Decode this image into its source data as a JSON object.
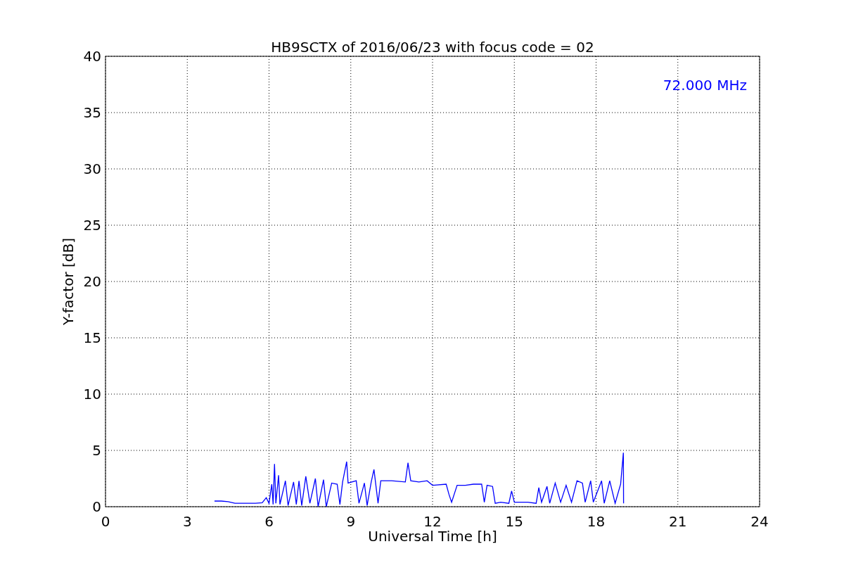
{
  "figure": {
    "chart_data": {
      "type": "line",
      "title": "HB9SCTX of 2016/06/23 with focus code = 02",
      "xlabel": "Universal Time [h]",
      "ylabel": "Y-factor [dB]",
      "xlim": [
        0,
        24
      ],
      "ylim": [
        0,
        40
      ],
      "xticks": [
        0,
        3,
        6,
        9,
        12,
        15,
        18,
        21,
        24
      ],
      "yticks": [
        0,
        5,
        10,
        15,
        20,
        25,
        30,
        35,
        40
      ],
      "x": [
        4.0,
        4.25,
        4.5,
        4.75,
        5.0,
        5.25,
        5.5,
        5.75,
        5.9,
        6.0,
        6.1,
        6.15,
        6.2,
        6.25,
        6.35,
        6.4,
        6.6,
        6.7,
        6.9,
        7.0,
        7.1,
        7.2,
        7.35,
        7.5,
        7.7,
        7.8,
        8.0,
        8.1,
        8.3,
        8.5,
        8.6,
        8.7,
        8.85,
        8.9,
        9.2,
        9.3,
        9.5,
        9.6,
        9.75,
        9.85,
        10.0,
        10.1,
        10.5,
        11.0,
        11.1,
        11.2,
        11.5,
        11.8,
        12.0,
        12.5,
        12.6,
        12.7,
        12.9,
        13.2,
        13.5,
        13.8,
        13.9,
        14.0,
        14.2,
        14.3,
        14.5,
        14.8,
        14.9,
        15.0,
        15.5,
        15.8,
        15.9,
        16.0,
        16.2,
        16.3,
        16.5,
        16.7,
        16.9,
        17.1,
        17.3,
        17.5,
        17.6,
        17.8,
        17.9,
        18.2,
        18.3,
        18.5,
        18.7,
        18.9,
        19.0,
        19.01
      ],
      "grid": true,
      "series": [
        {
          "color": "#0000ff",
          "values": [
            0.5,
            0.5,
            0.45,
            0.3,
            0.3,
            0.3,
            0.3,
            0.35,
            0.8,
            0.3,
            2.0,
            0.2,
            3.8,
            0.3,
            2.8,
            0.2,
            2.3,
            0.1,
            2.2,
            0.2,
            2.3,
            0.1,
            2.7,
            0.3,
            2.5,
            0.0,
            2.4,
            0.0,
            2.1,
            2.0,
            0.2,
            2.2,
            4.0,
            2.1,
            2.3,
            0.3,
            2.1,
            0.1,
            2.2,
            3.3,
            0.3,
            2.3,
            2.3,
            2.2,
            3.9,
            2.3,
            2.2,
            2.3,
            1.9,
            2.0,
            1.1,
            0.4,
            1.9,
            1.9,
            2.0,
            2.0,
            0.4,
            1.9,
            1.8,
            0.3,
            0.4,
            0.3,
            1.4,
            0.4,
            0.4,
            0.3,
            1.7,
            0.4,
            1.8,
            0.3,
            2.1,
            0.4,
            1.9,
            0.4,
            2.3,
            2.1,
            0.4,
            2.3,
            0.4,
            2.3,
            0.3,
            2.3,
            0.3,
            2.0,
            4.8,
            0.3
          ]
        }
      ],
      "annotations": [
        {
          "text": "72.000 MHz"
        }
      ]
    }
  }
}
